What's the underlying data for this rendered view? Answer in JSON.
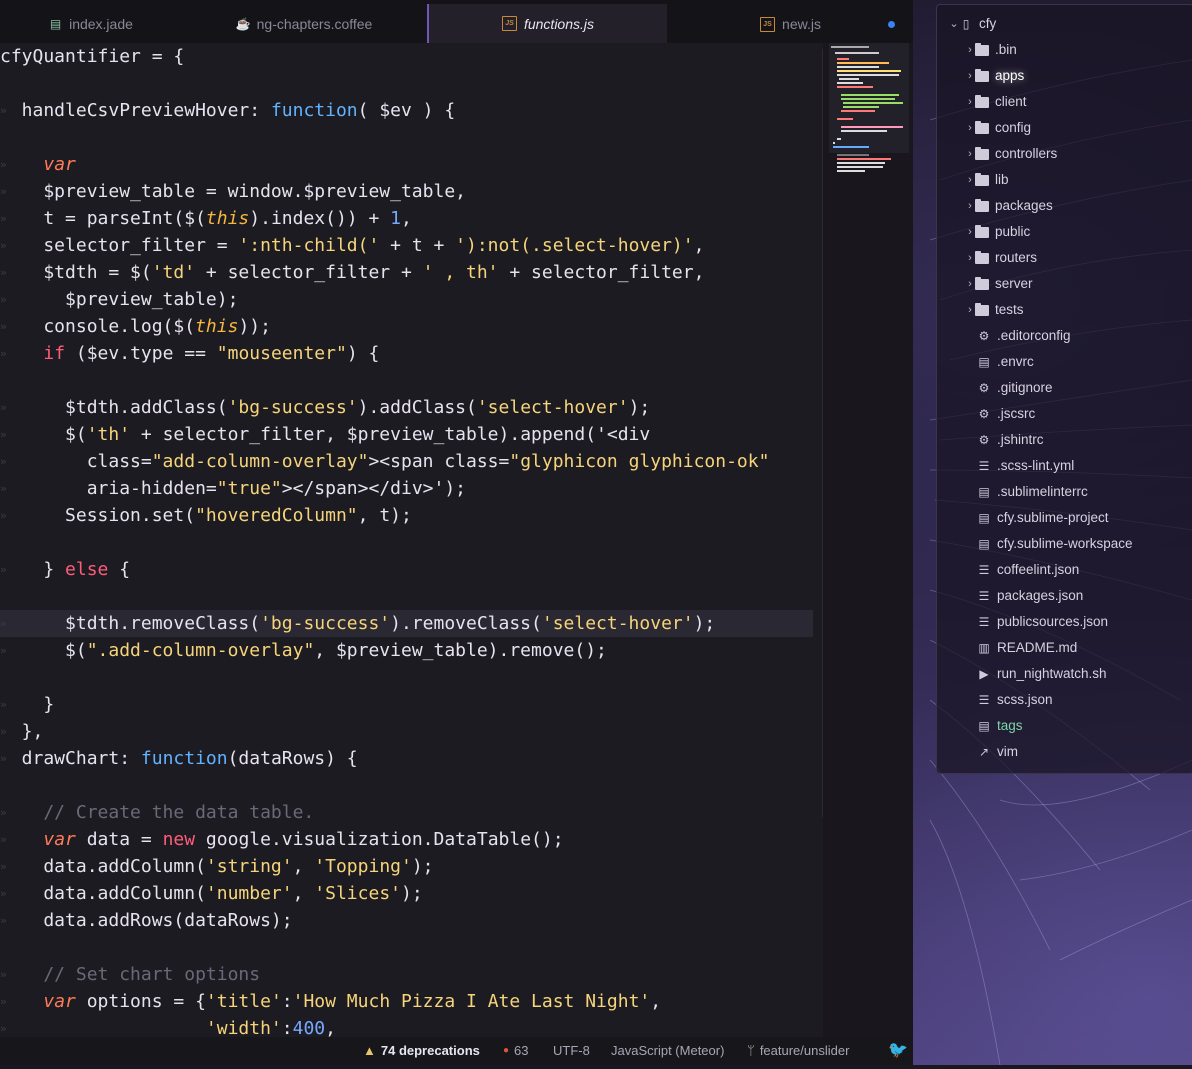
{
  "tabs": [
    {
      "label": "index.jade",
      "icon": "jade-file-icon"
    },
    {
      "label": "ng-chapters.coffee",
      "icon": "coffee-file-icon"
    },
    {
      "label": "functions.js",
      "icon": "js-file-icon",
      "active": true
    },
    {
      "label": "new.js",
      "icon": "js-file-icon",
      "modified": true
    }
  ],
  "status": {
    "deprecations": "74 deprecations",
    "errors": "63",
    "encoding": "UTF-8",
    "grammar": "JavaScript (Meteor)",
    "branch": "feature/unslider"
  },
  "tree": {
    "root": "cfy",
    "items": [
      {
        "label": ".bin",
        "type": "folder"
      },
      {
        "label": "apps",
        "type": "folder",
        "selected": true
      },
      {
        "label": "client",
        "type": "folder"
      },
      {
        "label": "config",
        "type": "folder"
      },
      {
        "label": "controllers",
        "type": "folder"
      },
      {
        "label": "lib",
        "type": "folder"
      },
      {
        "label": "packages",
        "type": "folder"
      },
      {
        "label": "public",
        "type": "folder"
      },
      {
        "label": "routers",
        "type": "folder"
      },
      {
        "label": "server",
        "type": "folder"
      },
      {
        "label": "tests",
        "type": "folder"
      },
      {
        "label": ".editorconfig",
        "type": "gear"
      },
      {
        "label": ".envrc",
        "type": "file"
      },
      {
        "label": ".gitignore",
        "type": "gear"
      },
      {
        "label": ".jscsrc",
        "type": "gear"
      },
      {
        "label": ".jshintrc",
        "type": "gear"
      },
      {
        "label": ".scss-lint.yml",
        "type": "db"
      },
      {
        "label": ".sublimelinterrc",
        "type": "file"
      },
      {
        "label": "cfy.sublime-project",
        "type": "file"
      },
      {
        "label": "cfy.sublime-workspace",
        "type": "file"
      },
      {
        "label": "coffeelint.json",
        "type": "db"
      },
      {
        "label": "packages.json",
        "type": "db"
      },
      {
        "label": "publicsources.json",
        "type": "db"
      },
      {
        "label": "README.md",
        "type": "book"
      },
      {
        "label": "run_nightwatch.sh",
        "type": "terminal"
      },
      {
        "label": "scss.json",
        "type": "db"
      },
      {
        "label": "tags",
        "type": "file",
        "accent": true
      },
      {
        "label": "vim",
        "type": "link"
      }
    ]
  },
  "code_lines": [
    "cfyQuantifier = {",
    "",
    "  handleCsvPreviewHover: function( $ev ) {",
    "",
    "    var",
    "    $preview_table = window.$preview_table,",
    "    t = parseInt($(this).index()) + 1,",
    "    selector_filter = ':nth-child(' + t + '):not(.select-hover)',",
    "    $tdth = $('td' + selector_filter + ' , th' + selector_filter,",
    "      $preview_table);",
    "    console.log($(this));",
    "    if ($ev.type == \"mouseenter\") {",
    "",
    "      $tdth.addClass('bg-success').addClass('select-hover');",
    "      $('th' + selector_filter, $preview_table).append('<div",
    "        class=\"add-column-overlay\"><span class=\"glyphicon glyphicon-ok\"",
    "        aria-hidden=\"true\"></span></div>');",
    "      Session.set(\"hoveredColumn\", t);",
    "",
    "    } else {",
    "",
    "      $tdth.removeClass('bg-success').removeClass('select-hover');",
    "      $(\".add-column-overlay\", $preview_table).remove();",
    "",
    "    }",
    "  },",
    "  drawChart: function(dataRows) {",
    "",
    "    // Create the data table.",
    "    var data = new google.visualization.DataTable();",
    "    data.addColumn('string', 'Topping');",
    "    data.addColumn('number', 'Slices');",
    "    data.addRows(dataRows);",
    "",
    "    // Set chart options",
    "    var options = {'title':'How Much Pizza I Ate Last Night',",
    "                   'width':400,"
  ]
}
